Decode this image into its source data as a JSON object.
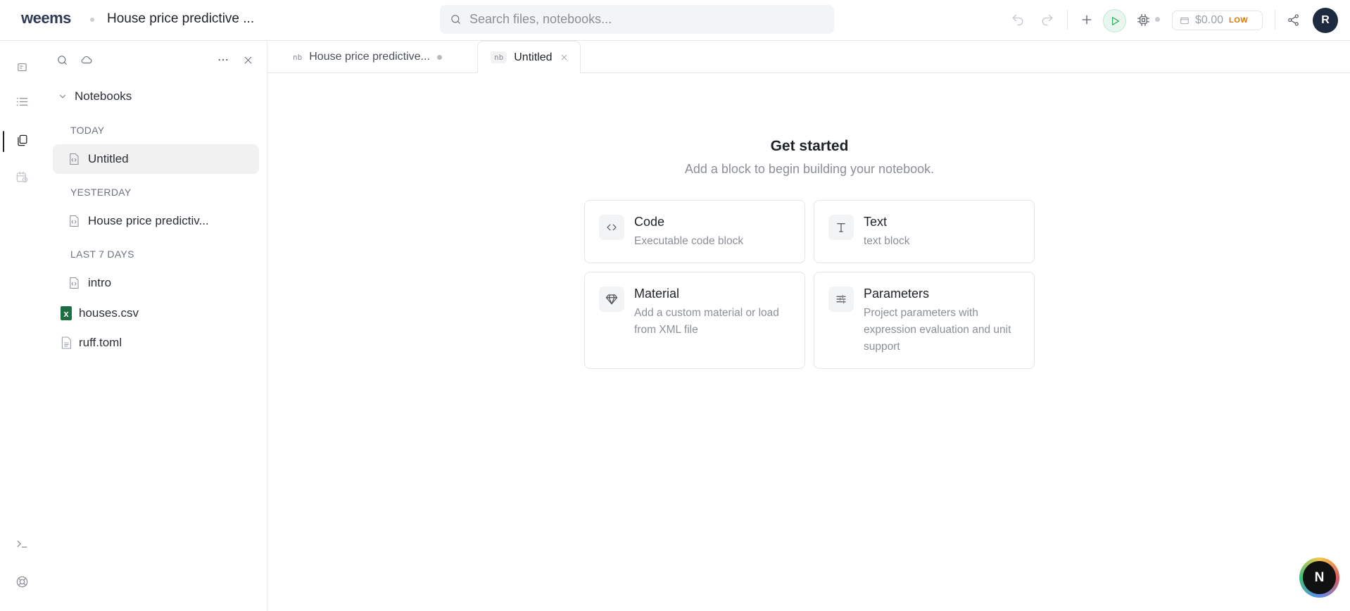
{
  "app": {
    "logo": "weems",
    "project_title": "House price predictive ..."
  },
  "search": {
    "placeholder": "Search files, notebooks..."
  },
  "toolbar": {
    "cost_amount": "$0.00",
    "cost_level": "LOW",
    "avatar_initial": "R"
  },
  "explorer": {
    "root_label": "Notebooks",
    "groups": [
      {
        "label": "TODAY",
        "items": [
          {
            "name": "Untitled",
            "active": true
          }
        ]
      },
      {
        "label": "YESTERDAY",
        "items": [
          {
            "name": "House price predictiv...",
            "active": false
          }
        ]
      },
      {
        "label": "LAST 7 DAYS",
        "items": [
          {
            "name": "intro",
            "active": false
          }
        ]
      }
    ],
    "files": [
      {
        "name": "houses.csv",
        "icon": "excel-icon"
      },
      {
        "name": "ruff.toml",
        "icon": "file-icon"
      }
    ]
  },
  "tabs": [
    {
      "prefix": "nb",
      "label": "House price predictive...",
      "active": false,
      "unsaved": true
    },
    {
      "prefix": "nb",
      "label": "Untitled",
      "active": true,
      "unsaved": false
    }
  ],
  "main": {
    "title": "Get started",
    "subtitle": "Add a block to begin building your notebook.",
    "cards": [
      {
        "title": "Code",
        "description": "Executable code block",
        "icon": "code-icon"
      },
      {
        "title": "Text",
        "description": "text block",
        "icon": "text-icon"
      },
      {
        "title": "Material",
        "description": "Add a custom material or load from XML file",
        "icon": "diamond-icon"
      },
      {
        "title": "Parameters",
        "description": "Project parameters with expression evaluation and unit support",
        "icon": "sliders-icon"
      }
    ]
  },
  "assistant": {
    "initial": "N"
  },
  "colors": {
    "run_green": "#16a34a",
    "cost_level": "#d97706",
    "avatar_bg": "#1e2a3f",
    "excel_green": "#1d6f42"
  }
}
